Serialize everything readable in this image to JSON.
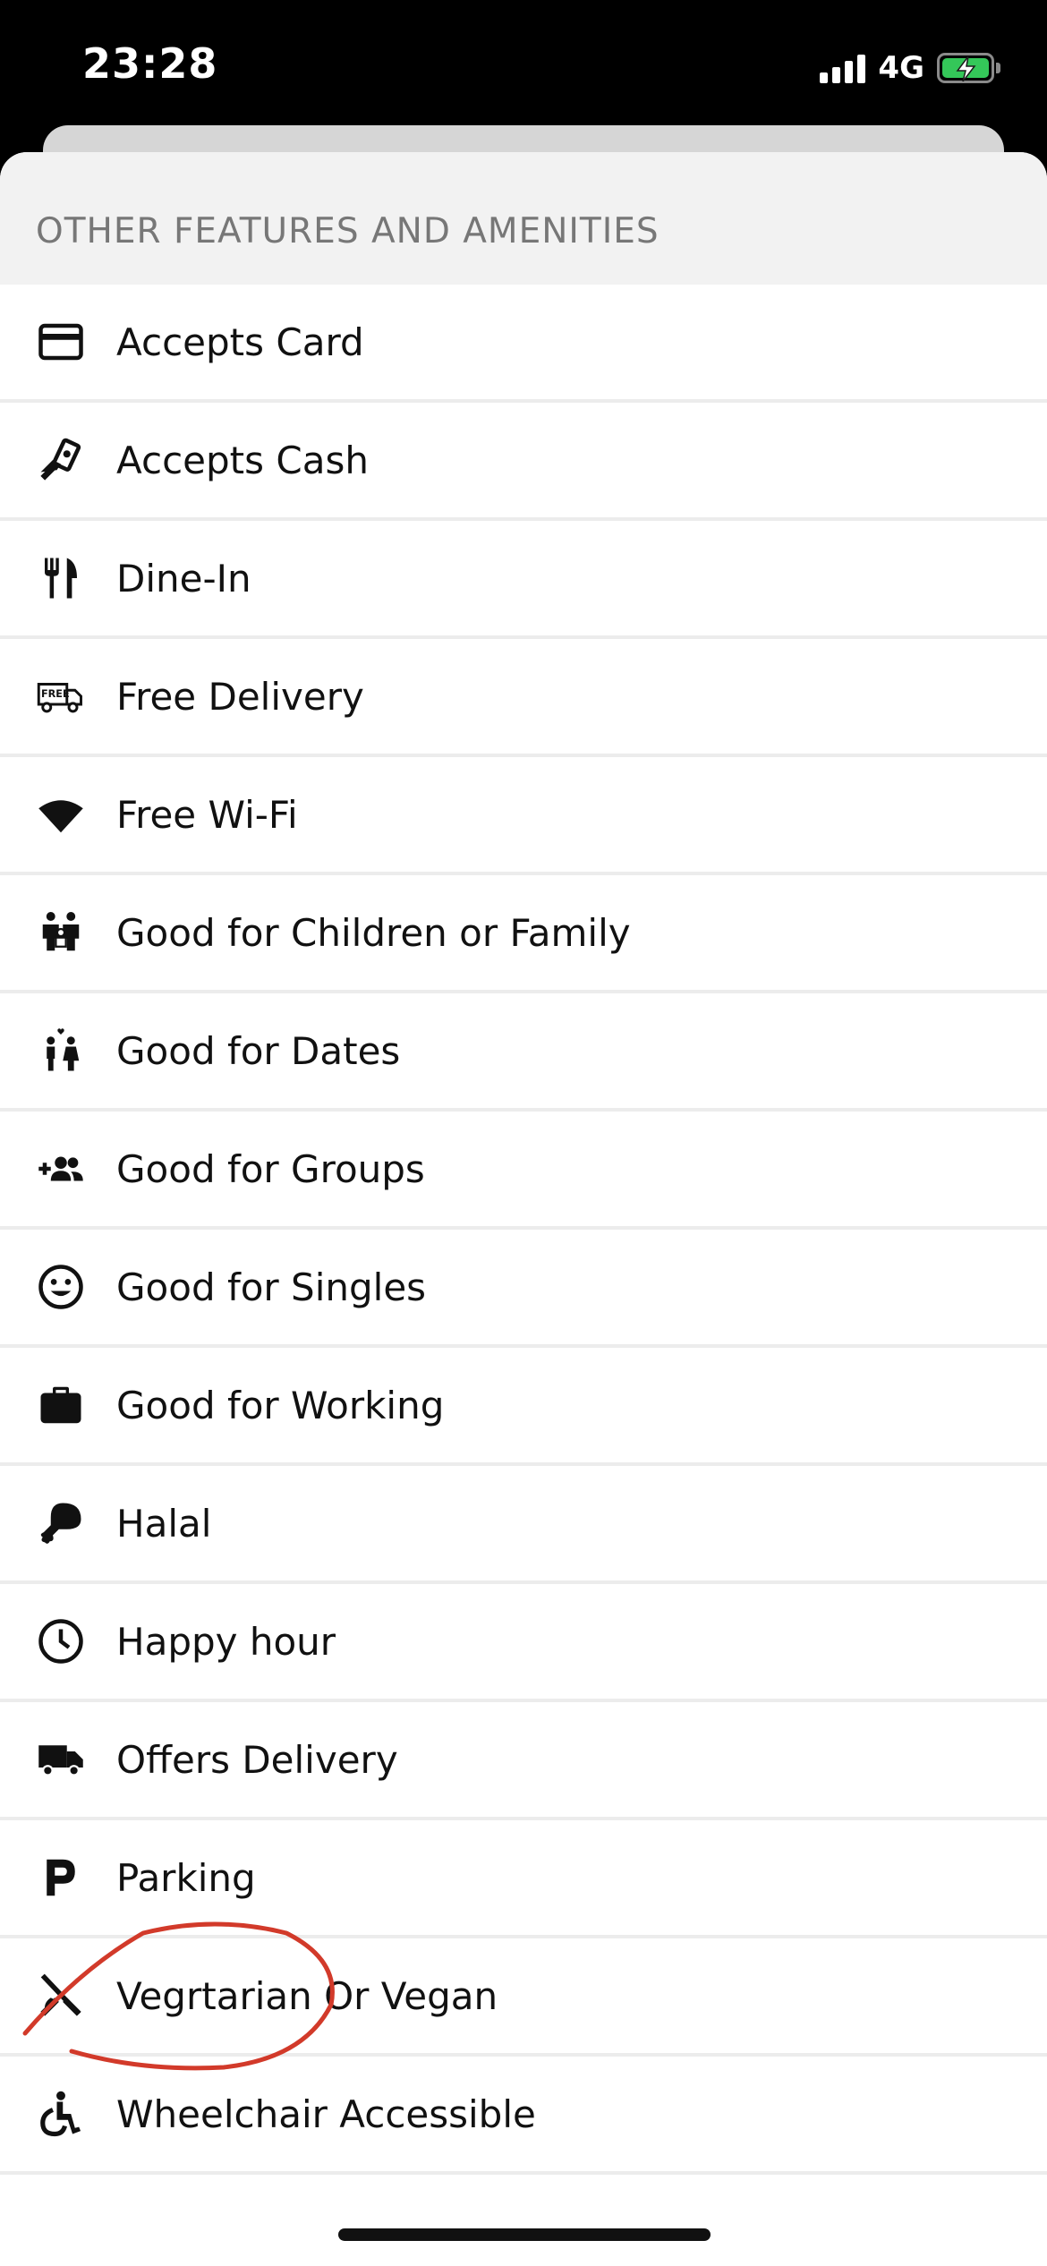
{
  "status_bar": {
    "time": "23:28",
    "network": "4G",
    "icons": [
      "signal-bars-icon",
      "battery-charging-icon"
    ],
    "battery_color": "#34c759"
  },
  "section": {
    "title": "OTHER FEATURES AND AMENITIES"
  },
  "amenities": [
    {
      "label": "Accepts Card",
      "icon": "credit-card-icon"
    },
    {
      "label": "Accepts Cash",
      "icon": "cash-hand-icon"
    },
    {
      "label": "Dine-In",
      "icon": "fork-knife-icon"
    },
    {
      "label": "Free Delivery",
      "icon": "free-delivery-truck-icon"
    },
    {
      "label": "Free Wi-Fi",
      "icon": "wifi-icon"
    },
    {
      "label": "Good for Children or Family",
      "icon": "family-icon"
    },
    {
      "label": "Good for Dates",
      "icon": "couple-icon"
    },
    {
      "label": "Good for Groups",
      "icon": "group-add-icon"
    },
    {
      "label": "Good for Singles",
      "icon": "smiley-icon"
    },
    {
      "label": "Good for Working",
      "icon": "briefcase-icon"
    },
    {
      "label": "Halal",
      "icon": "drumstick-icon"
    },
    {
      "label": "Happy hour",
      "icon": "clock-icon"
    },
    {
      "label": "Offers Delivery",
      "icon": "delivery-truck-icon"
    },
    {
      "label": "Parking",
      "icon": "parking-icon"
    },
    {
      "label": "Vegrtarian Or Vegan",
      "icon": "no-meat-icon"
    },
    {
      "label": "Wheelchair Accessible",
      "icon": "wheelchair-icon"
    }
  ],
  "annotation_color": "#d23a2a"
}
